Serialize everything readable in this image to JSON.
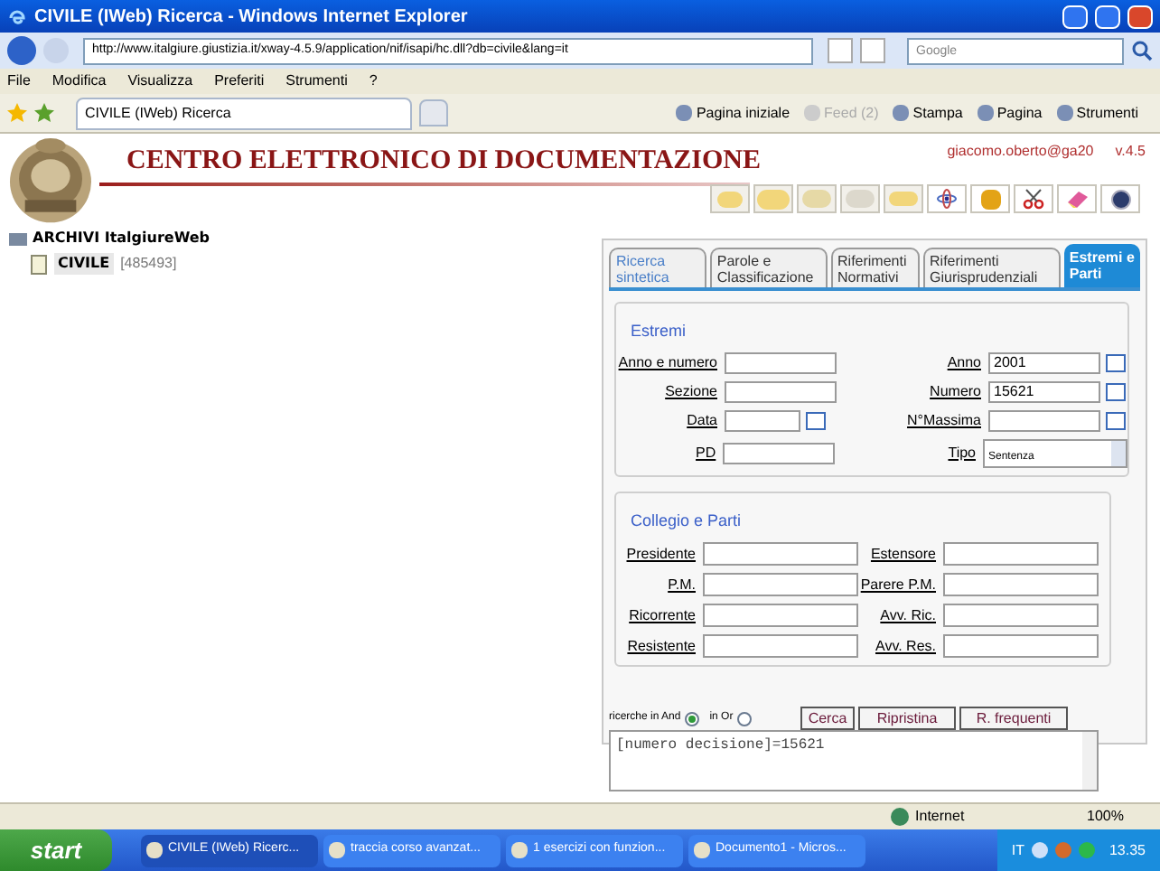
{
  "window": {
    "title": "CIVILE (IWeb) Ricerca - Windows Internet Explorer"
  },
  "address_bar": {
    "url": "http://www.italgiure.giustizia.it/xway-4.5.9/application/nif/isapi/hc.dll?db=civile&lang=it",
    "search_placeholder": "Google"
  },
  "menu": [
    "File",
    "Modifica",
    "Visualizza",
    "Preferiti",
    "Strumenti",
    "?"
  ],
  "browser_tab": {
    "label": "CIVILE (IWeb) Ricerca"
  },
  "command_bar": [
    {
      "label": "Pagina iniziale",
      "disabled": false
    },
    {
      "label": "Feed (2)",
      "disabled": true
    },
    {
      "label": "Stampa",
      "disabled": false
    },
    {
      "label": "Pagina",
      "disabled": false
    },
    {
      "label": "Strumenti",
      "disabled": false
    }
  ],
  "page": {
    "title": "CENTRO ELETTRONICO DI DOCUMENTAZIONE",
    "user": "giacomo.oberto@ga20",
    "version": "v.4.5"
  },
  "tree": {
    "label": "ARCHIVI ItalgiureWeb",
    "children": [
      {
        "label": "CIVILE",
        "count": "[485493]"
      }
    ]
  },
  "tabs": [
    {
      "label": "Ricerca sintetica",
      "selected": false
    },
    {
      "label": "Parole e Classificazione",
      "selected": false
    },
    {
      "label": "Riferimenti Normativi",
      "selected": false
    },
    {
      "label": "Riferimenti Giurisprudenziali",
      "selected": false
    },
    {
      "label": "Estremi e Parti",
      "selected": true
    }
  ],
  "estremi": {
    "legend": "Estremi",
    "rows": [
      [
        {
          "label": "Anno e numero",
          "kind": "text"
        },
        {
          "label": "Anno",
          "value": "2001",
          "kind": "text",
          "swap": true
        }
      ],
      [
        {
          "label": "Sezione",
          "kind": "text"
        },
        {
          "label": "Numero",
          "value": "15621",
          "kind": "text",
          "swap": true
        }
      ],
      [
        {
          "label": "Data",
          "kind": "short",
          "swap": true
        },
        {
          "label": "N°Massima",
          "kind": "text",
          "swap": true
        }
      ],
      [
        {
          "label": "PD",
          "kind": "text"
        },
        {
          "label": "Tipo",
          "value": "Sentenza",
          "kind": "select"
        }
      ]
    ]
  },
  "collegio": {
    "legend": "Collegio e Parti",
    "rows": [
      [
        {
          "label": "Presidente"
        },
        {
          "label": "Estensore"
        }
      ],
      [
        {
          "label": "P.M."
        },
        {
          "label": "Parere P.M."
        }
      ],
      [
        {
          "label": "Ricorrente"
        },
        {
          "label": "Avv. Ric."
        }
      ],
      [
        {
          "label": "Resistente"
        },
        {
          "label": "Avv. Res."
        }
      ]
    ]
  },
  "search_mode": [
    {
      "label": "ricerche in And",
      "selected": true
    },
    {
      "label": "in Or",
      "selected": false
    }
  ],
  "buttons": [
    "Cerca",
    "Ripristina",
    "R. frequenti"
  ],
  "query": "[numero decisione]=15621",
  "status_bar": {
    "zone": "Internet",
    "zoom": "100%"
  },
  "taskbar": {
    "start": "start",
    "items": [
      "CIVILE (IWeb) Ricerc...",
      "traccia corso avanzat...",
      "1 esercizi con funzion...",
      "Documento1 - Micros..."
    ],
    "language": "IT",
    "clock": "13.35"
  }
}
